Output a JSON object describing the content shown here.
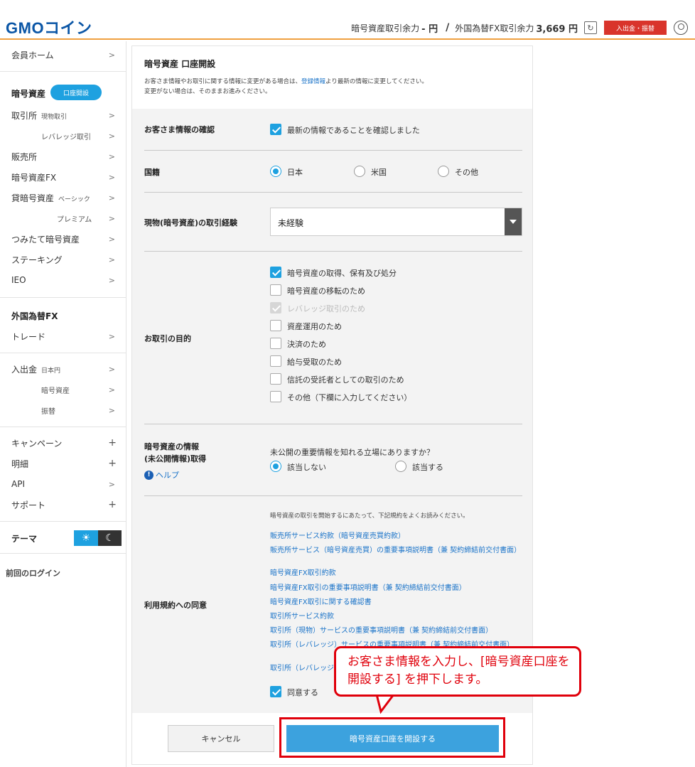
{
  "header": {
    "logo": "GMOコイン",
    "crypto_balance_label": "暗号資産取引余力",
    "crypto_balance_value": "- 円",
    "separator": "/",
    "fx_balance_label": "外国為替FX取引余力",
    "fx_balance_value": "3,669 円",
    "deposit_button": "入出金・振替"
  },
  "sidebar": {
    "member_home": "会員ホーム",
    "crypto_heading": "暗号資産",
    "open_account_pill": "口座開設",
    "exchange": "取引所",
    "exchange_spot": "現物取引",
    "exchange_leverage": "レバレッジ取引",
    "sales": "販売所",
    "crypto_fx": "暗号資産FX",
    "lending": "貸暗号資産",
    "lending_basic": "ベーシック",
    "lending_premium": "プレミアム",
    "tsumitate": "つみたて暗号資産",
    "staking": "ステーキング",
    "ieo": "IEO",
    "fx_heading": "外国為替FX",
    "trade": "トレード",
    "deposit": "入出金",
    "deposit_jpy": "日本円",
    "deposit_crypto": "暗号資産",
    "transfer": "振替",
    "campaign": "キャンペーン",
    "statement": "明細",
    "api": "API",
    "support": "サポート",
    "theme": "テーマ",
    "last_login": "前回のログイン"
  },
  "card": {
    "title": "暗号資産 口座開設",
    "desc_pre": "お客さま情報やお取引に関する情報に変更がある場合は、",
    "desc_link": "登録情報",
    "desc_post": "より最新の情報に変更してください。",
    "desc_line2": "変更がない場合は、そのままお進みください。"
  },
  "form": {
    "confirm_label": "お客さま情報の確認",
    "confirm_check": "最新の情報であることを確認しました",
    "nationality_label": "国籍",
    "nationality_options": [
      "日本",
      "米国",
      "その他"
    ],
    "experience_label": "現物(暗号資産)の取引経験",
    "experience_value": "未経験",
    "purpose_label": "お取引の目的",
    "purposes": [
      "暗号資産の取得、保有及び処分",
      "暗号資産の移転のため",
      "レバレッジ取引のため",
      "資産運用のため",
      "決済のため",
      "給与受取のため",
      "信託の受託者としての取引のため",
      "その他（下欄に入力してください）"
    ],
    "insider_label_1": "暗号資産の情報",
    "insider_label_2": "(未公開情報)取得",
    "help": "ヘルプ",
    "insider_question": "未公開の重要情報を知れる立場にありますか？",
    "insider_options": [
      "該当しない",
      "該当する"
    ],
    "terms_label": "利用規約への同意",
    "terms_intro": "暗号資産の取引を開始するにあたって、下記規約をよくお読みください。",
    "terms_links": [
      "販売所サービス約款（暗号資産売買約款）",
      "販売所サービス（暗号資産売買）の重要事項説明書（兼 契約締結前交付書面）",
      "暗号資産FX取引約款",
      "暗号資産FX取引の重要事項説明書（兼 契約締結前交付書面）",
      "暗号資産FX取引に関する確認書",
      "取引所サービス約款",
      "取引所（現物）サービスの重要事項説明書（兼 契約締結前交付書面）",
      "取引所（レバレッジ）サービスの重要事項説明書（兼 契約締結前交付書面）",
      "取引所（レバレッジ"
    ],
    "agree": "同意する",
    "cancel": "キャンセル",
    "submit": "暗号資産口座を開設する"
  },
  "callout": {
    "text": "お客さま情報を入力し、[暗号資産口座を開設する] を押下します。"
  },
  "colors": {
    "accent": "#1ea1e0",
    "submit": "#3ca2de",
    "highlight": "#e0000b",
    "logo": "#0b56a6"
  }
}
